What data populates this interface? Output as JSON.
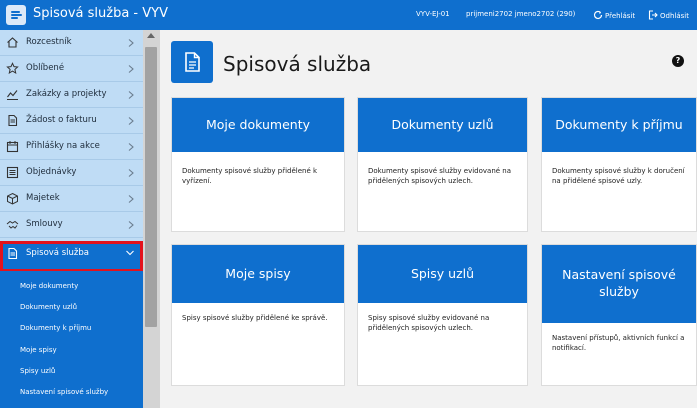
{
  "header": {
    "app_title": "Spisová služba - VYV",
    "environment": "VYV-EJ-01",
    "user": "prijmeni2702 jmeno2702 (290)",
    "relogin_label": "Přehlásit",
    "logout_label": "Odhlásit"
  },
  "sidebar": {
    "items": [
      {
        "label": "Rozcestník",
        "icon": "home-icon"
      },
      {
        "label": "Oblíbené",
        "icon": "star-icon"
      },
      {
        "label": "Zakázky a projekty",
        "icon": "chart-icon"
      },
      {
        "label": "Žádost o fakturu",
        "icon": "document-icon"
      },
      {
        "label": "Přihlášky na akce",
        "icon": "calendar-icon"
      },
      {
        "label": "Objednávky",
        "icon": "list-icon"
      },
      {
        "label": "Majetek",
        "icon": "box-icon"
      },
      {
        "label": "Smlouvy",
        "icon": "handshake-icon"
      },
      {
        "label": "Spisová služba",
        "icon": "file-icon",
        "active": true
      }
    ],
    "sub_items": [
      {
        "label": "Moje dokumenty"
      },
      {
        "label": "Dokumenty uzlů"
      },
      {
        "label": "Dokumenty k příjmu"
      },
      {
        "label": "Moje spisy"
      },
      {
        "label": "Spisy uzlů"
      },
      {
        "label": "Nastavení spisové služby"
      }
    ]
  },
  "main": {
    "title": "Spisová služba",
    "help": "?",
    "cards": [
      {
        "title": "Moje dokumenty",
        "desc": "Dokumenty spisové služby přidělené k vyřízení."
      },
      {
        "title": "Dokumenty uzlů",
        "desc": "Dokumenty spisové služby evidované na přidělených spisových uzlech."
      },
      {
        "title": "Dokumenty k příjmu",
        "desc": "Dokumenty spisové služby k doručení na přidělené spisové uzly."
      },
      {
        "title": "Moje spisy",
        "desc": "Spisy spisové služby přidělené ke správě."
      },
      {
        "title": "Spisy uzlů",
        "desc": "Spisy spisové služby evidované na přidělených spisových uzlech."
      },
      {
        "title": "Nastavení spisové služby",
        "desc": "Nastavení přístupů, aktivních funkcí a notifikací."
      }
    ]
  },
  "colors": {
    "primary": "#0f6fce",
    "sidebar_bg": "#bfdcf5",
    "highlight_border": "#e3121c"
  }
}
